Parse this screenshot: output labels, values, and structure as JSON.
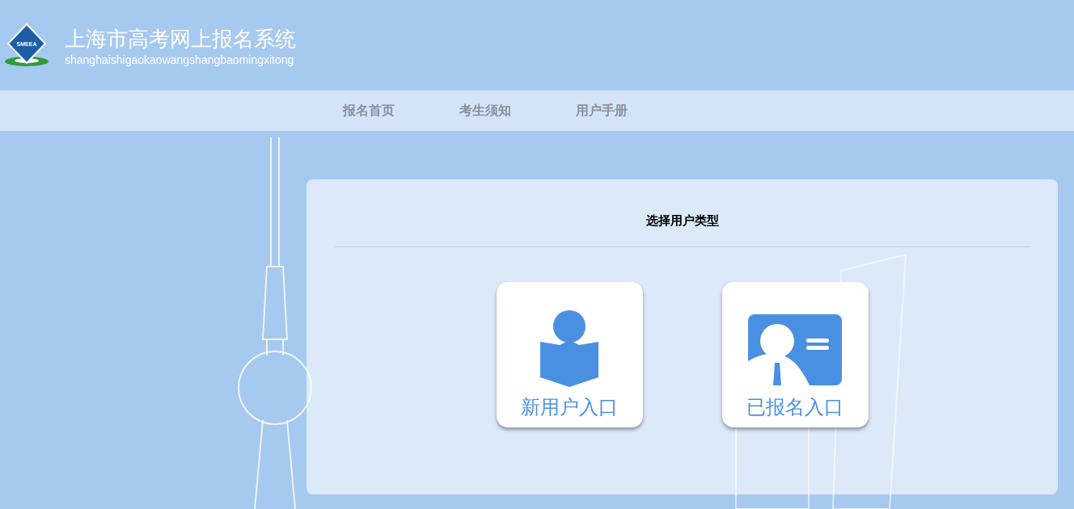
{
  "header": {
    "title": "上海市高考网上报名系统",
    "subtitle": "shanghaishigaokaowangshangbaomingxitong",
    "logo_text": "SMEEA"
  },
  "nav": [
    {
      "label": "报名首页"
    },
    {
      "label": "考生须知"
    },
    {
      "label": "用户手册"
    }
  ],
  "panel": {
    "title": "选择用户类型",
    "entries": [
      {
        "kind": "reader",
        "label": "新用户入口"
      },
      {
        "kind": "id-card",
        "label": "已报名入口"
      }
    ]
  }
}
